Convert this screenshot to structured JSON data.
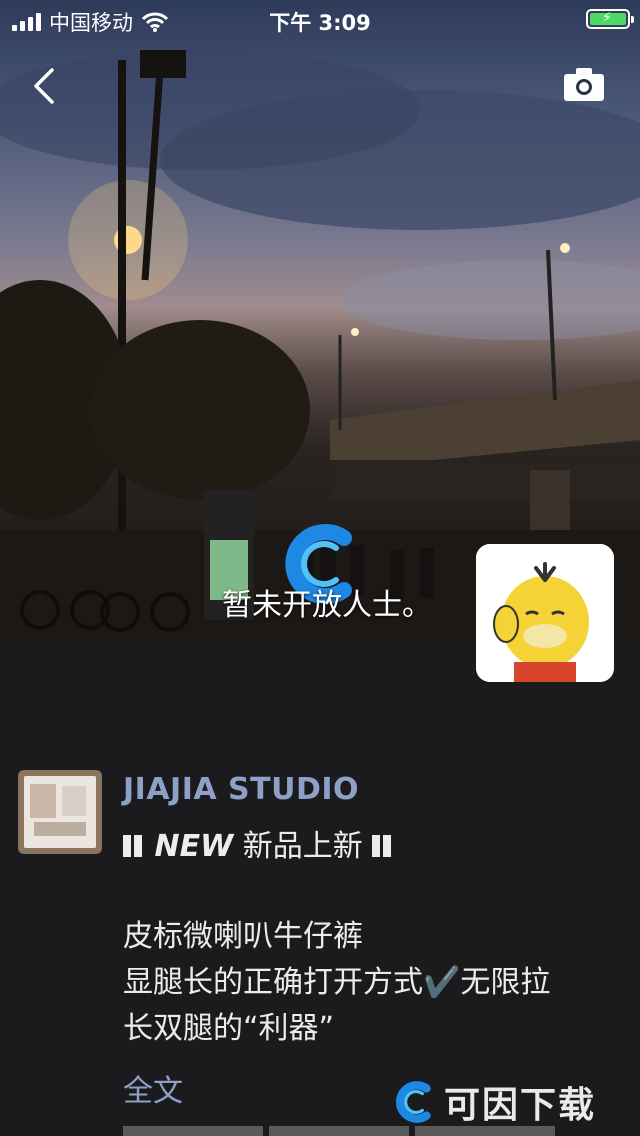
{
  "status_bar": {
    "carrier": "中国移动",
    "time": "下午 3:09"
  },
  "cover": {
    "caption": "暂未开放人士。",
    "icons": [
      "back-icon",
      "camera-icon"
    ]
  },
  "post": {
    "author": "JIAJIA STUDIO",
    "new_tag": "NEW",
    "headline": "新品上新",
    "text_line1": "皮标微喇叭牛仔裤",
    "text_line2": "显腿长的正确打开方式✔️无限拉",
    "text_line3": "长双腿的“利器”",
    "full_text": "全文"
  },
  "watermark": {
    "text": "可因下载"
  },
  "colors": {
    "link": "#8da0c8",
    "background": "#1b1b1d",
    "battery": "#4cd964"
  }
}
